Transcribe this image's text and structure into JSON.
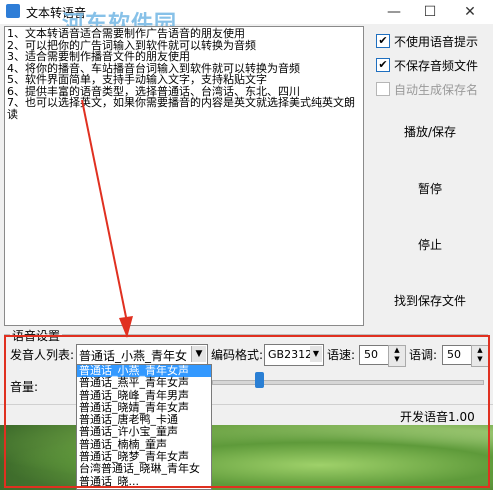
{
  "window": {
    "title": "文本转语音",
    "watermark": "河东软件园",
    "minimize_glyph": "—",
    "maximize_glyph": "☐",
    "close_glyph": "✕"
  },
  "text_area": {
    "content": "1、文本转语音适合需要制作广告语音的朋友使用\n2、可以把你的广告词输入到软件就可以转换为音频\n3、适合需要制作播音文件的朋友使用\n4、将你的播音、车站播音台词输入到软件就可以转换为音频\n5、软件界面简单，支持手动输入文字，支持粘贴文字\n6、提供丰富的语音类型，选择普通话、台湾话、东北、四川\n7、也可以选择英文，如果你需要播音的内容是英文就选择美式纯英文朗读"
  },
  "options": {
    "no_voice_prompt": {
      "label": "不使用语音提示",
      "checked": true
    },
    "no_save_audio": {
      "label": "不保存音频文件",
      "checked": true
    },
    "auto_save_name": {
      "label": "自动生成保存名",
      "checked": false,
      "disabled": true
    }
  },
  "buttons": {
    "play_save": "播放/保存",
    "pause": "暂停",
    "stop": "停止",
    "find_file": "找到保存文件"
  },
  "voice_settings": {
    "group_label": "语音设置",
    "speaker_label": "发音人列表:",
    "speaker_value": "普通话_小燕_青年女",
    "encoding_label": "编码格式:",
    "encoding_value": "GB2312",
    "rate_label": "语速:",
    "rate_value": "50",
    "pitch_label": "语调:",
    "pitch_value": "50",
    "volume_label": "音量:",
    "volume_level": 0.16
  },
  "speaker_options": [
    "普通话_小燕_青年女声",
    "普通话_燕平_青年女声",
    "普通话_晓峰_青年男声",
    "普通话_晓婧_青年女声",
    "普通话_唐老鸭_卡通",
    "普通话_许小宝_童声",
    "普通话_楠楠_童声",
    "普通话_晓梦_青年女声",
    "台湾普通话_晓琳_青年女",
    "普通话_晓..."
  ],
  "status": {
    "text": "开发语音1.00"
  },
  "annotation_color": "#e03020"
}
